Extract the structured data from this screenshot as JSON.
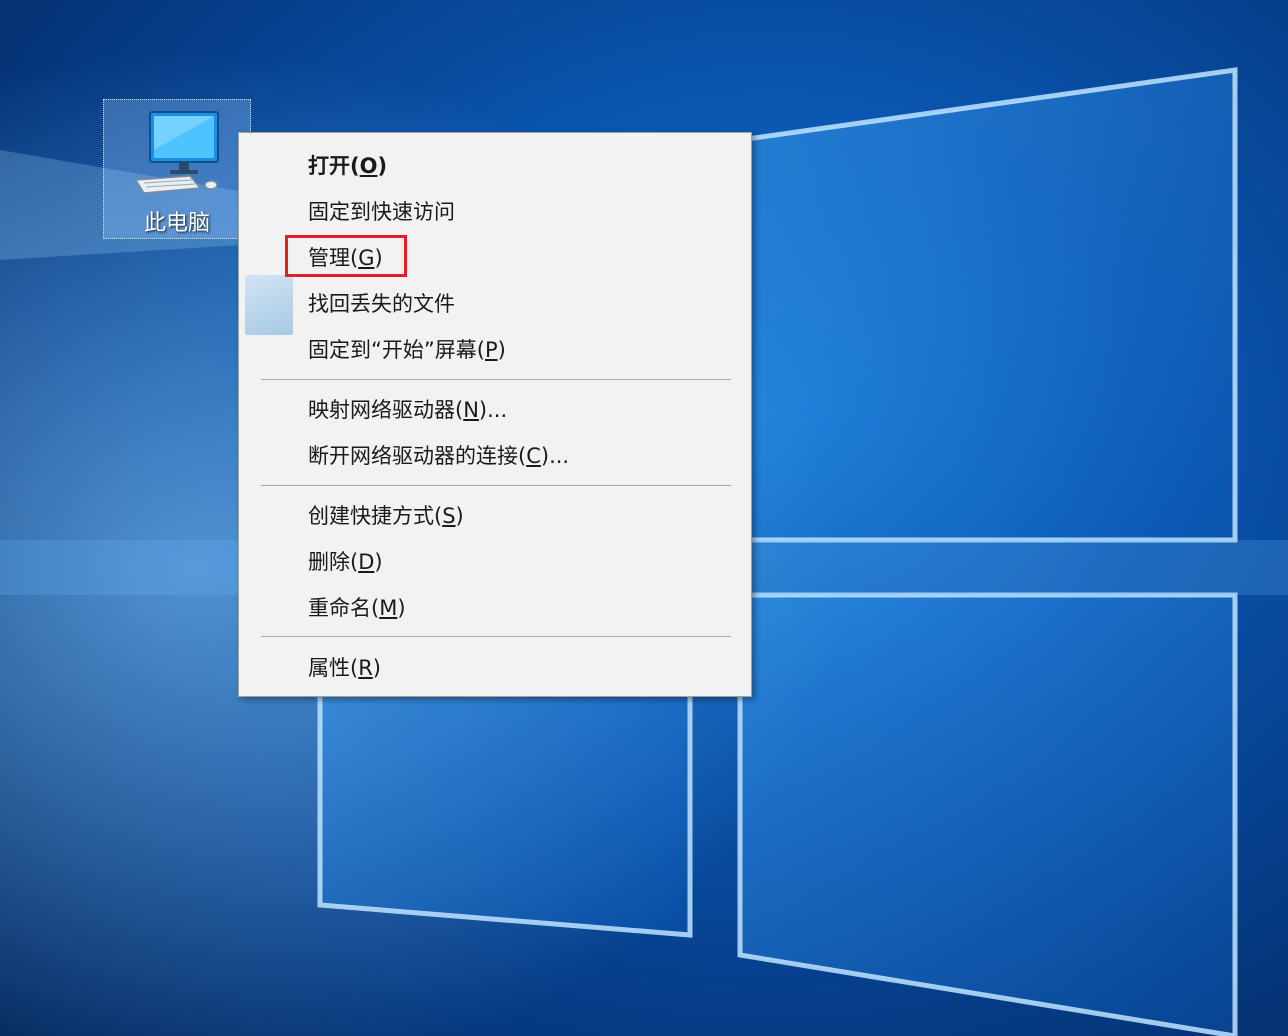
{
  "desktop": {
    "icons": [
      {
        "label": "此电脑",
        "icon": "computer-icon"
      }
    ]
  },
  "context_menu": {
    "groups": [
      [
        {
          "text": "打开",
          "accel": "O",
          "bold": true
        },
        {
          "text": "固定到快速访问"
        },
        {
          "text": "管理",
          "accel": "G",
          "highlighted": true
        },
        {
          "text": "找回丢失的文件",
          "icon": "file-recovery-icon"
        },
        {
          "text": "固定到“开始”屏幕",
          "accel": "P"
        }
      ],
      [
        {
          "text": "映射网络驱动器",
          "accel": "N",
          "suffix": "..."
        },
        {
          "text": "断开网络驱动器的连接",
          "accel": "C",
          "suffix": "..."
        }
      ],
      [
        {
          "text": "创建快捷方式",
          "accel": "S"
        },
        {
          "text": "删除",
          "accel": "D"
        },
        {
          "text": "重命名",
          "accel": "M"
        }
      ],
      [
        {
          "text": "属性",
          "accel": "R"
        }
      ]
    ],
    "highlight_color": "#e0202a"
  }
}
